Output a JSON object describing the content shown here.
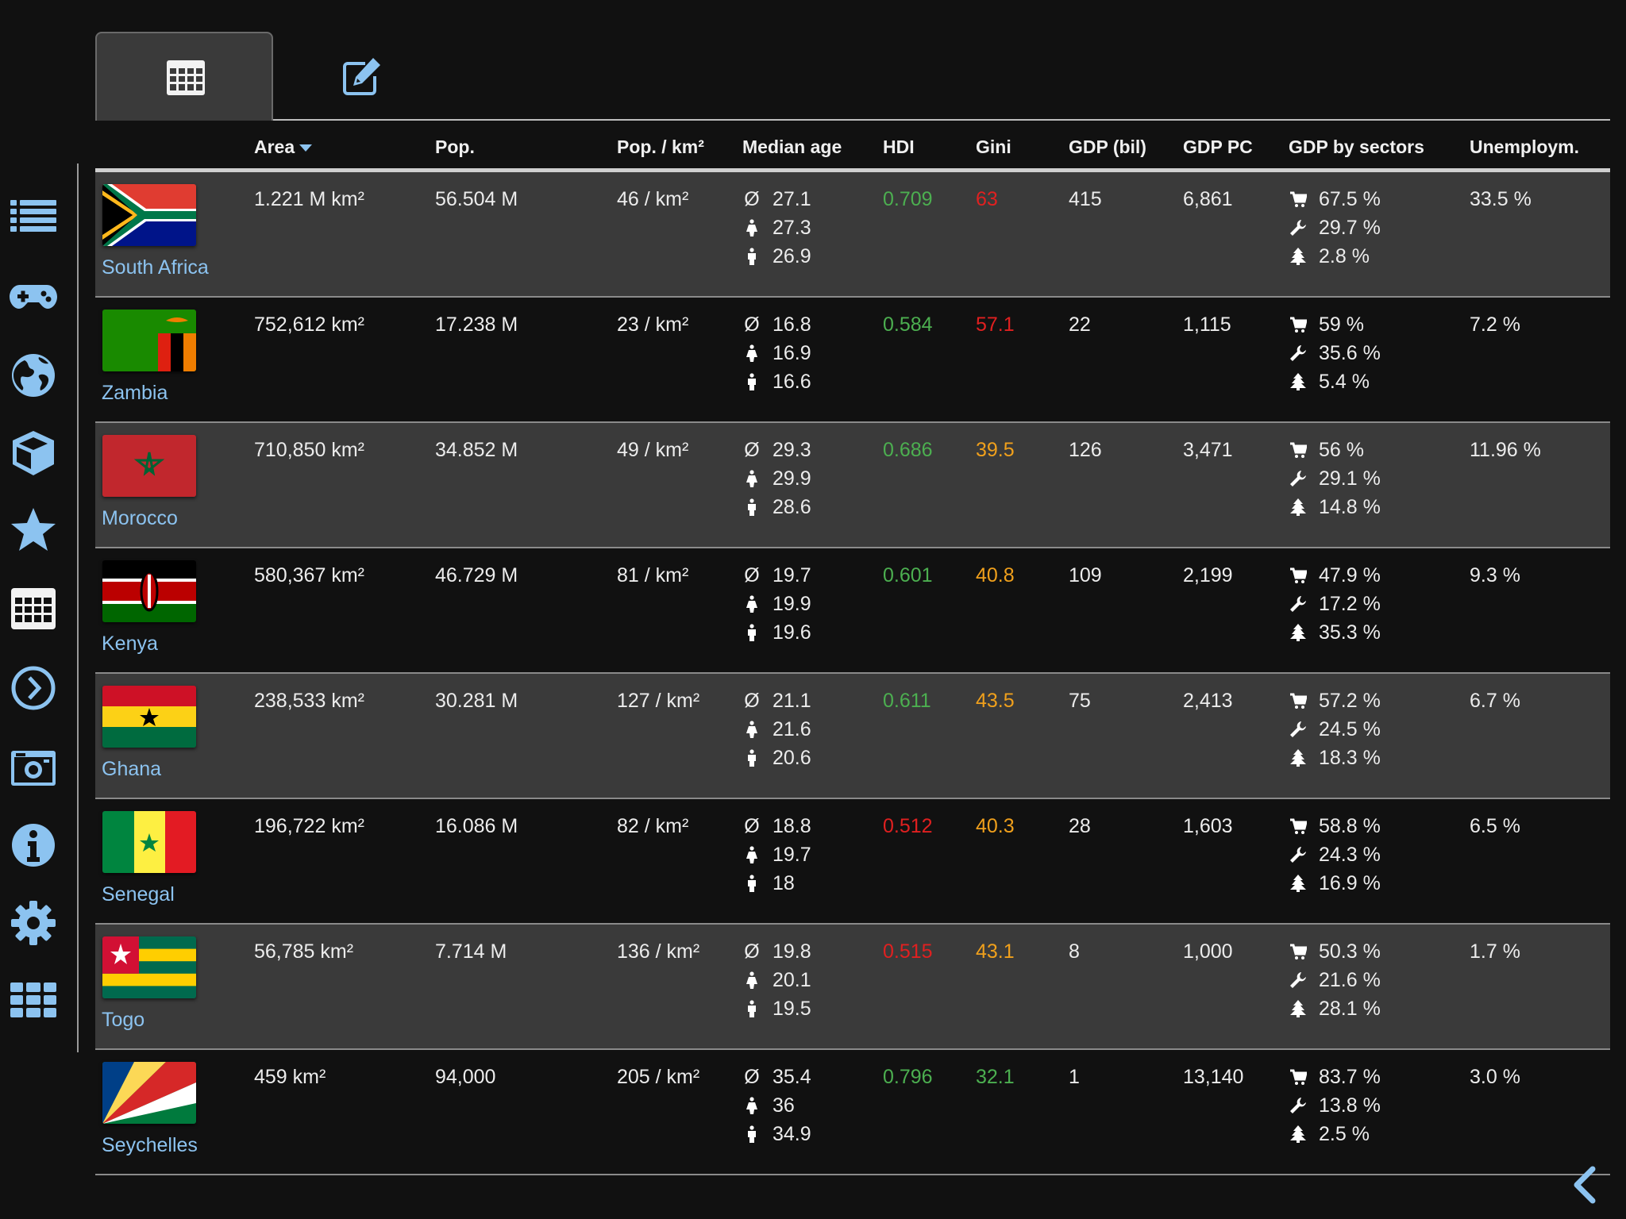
{
  "colors": {
    "accent": "#8cc3f0",
    "good": "#4caf50",
    "bad": "#e02020",
    "medium": "#f0a01c",
    "row_alt": "#3a3a3a"
  },
  "sidebar": {
    "icons": [
      "list-icon",
      "gamepad-icon",
      "globe-icon",
      "cube-icon",
      "star-icon",
      "calendar-grid-icon",
      "clock-arrow-icon",
      "camera-icon",
      "info-icon",
      "gear-icon",
      "apps-grid-icon"
    ]
  },
  "tabs": [
    {
      "icon": "table-icon",
      "active": true
    },
    {
      "icon": "edit-icon",
      "active": false
    }
  ],
  "table": {
    "columns": [
      "Area",
      "Pop.",
      "Pop. / km²",
      "Median age",
      "HDI",
      "Gini",
      "GDP (bil)",
      "GDP PC",
      "GDP by sectors",
      "Unemploym."
    ],
    "sorted_column": "Area",
    "age_symbol": "Ø",
    "rows": [
      {
        "country": "South Africa",
        "flag": "south-africa-flag",
        "area": "1.221 M km²",
        "pop": "56.504 M",
        "density": "46 / km²",
        "age_avg": "27.1",
        "age_f": "27.3",
        "age_m": "26.9",
        "hdi": "0.709",
        "hdi_level": "good",
        "gini": "63",
        "gini_level": "bad",
        "gdp": "415",
        "gdppc": "6,861",
        "services": "67.5 %",
        "industry": "29.7 %",
        "agriculture": "2.8 %",
        "unemp": "33.5 %"
      },
      {
        "country": "Zambia",
        "flag": "zambia-flag",
        "area": "752,612 km²",
        "pop": "17.238 M",
        "density": "23 / km²",
        "age_avg": "16.8",
        "age_f": "16.9",
        "age_m": "16.6",
        "hdi": "0.584",
        "hdi_level": "good",
        "gini": "57.1",
        "gini_level": "bad",
        "gdp": "22",
        "gdppc": "1,115",
        "services": "59 %",
        "industry": "35.6 %",
        "agriculture": "5.4 %",
        "unemp": "7.2 %"
      },
      {
        "country": "Morocco",
        "flag": "morocco-flag",
        "area": "710,850 km²",
        "pop": "34.852 M",
        "density": "49 / km²",
        "age_avg": "29.3",
        "age_f": "29.9",
        "age_m": "28.6",
        "hdi": "0.686",
        "hdi_level": "good",
        "gini": "39.5",
        "gini_level": "medium",
        "gdp": "126",
        "gdppc": "3,471",
        "services": "56 %",
        "industry": "29.1 %",
        "agriculture": "14.8 %",
        "unemp": "11.96 %"
      },
      {
        "country": "Kenya",
        "flag": "kenya-flag",
        "area": "580,367 km²",
        "pop": "46.729 M",
        "density": "81 / km²",
        "age_avg": "19.7",
        "age_f": "19.9",
        "age_m": "19.6",
        "hdi": "0.601",
        "hdi_level": "good",
        "gini": "40.8",
        "gini_level": "medium",
        "gdp": "109",
        "gdppc": "2,199",
        "services": "47.9 %",
        "industry": "17.2 %",
        "agriculture": "35.3 %",
        "unemp": "9.3 %"
      },
      {
        "country": "Ghana",
        "flag": "ghana-flag",
        "area": "238,533 km²",
        "pop": "30.281 M",
        "density": "127 / km²",
        "age_avg": "21.1",
        "age_f": "21.6",
        "age_m": "20.6",
        "hdi": "0.611",
        "hdi_level": "good",
        "gini": "43.5",
        "gini_level": "medium",
        "gdp": "75",
        "gdppc": "2,413",
        "services": "57.2 %",
        "industry": "24.5 %",
        "agriculture": "18.3 %",
        "unemp": "6.7 %"
      },
      {
        "country": "Senegal",
        "flag": "senegal-flag",
        "area": "196,722 km²",
        "pop": "16.086 M",
        "density": "82 / km²",
        "age_avg": "18.8",
        "age_f": "19.7",
        "age_m": "18",
        "hdi": "0.512",
        "hdi_level": "bad",
        "gini": "40.3",
        "gini_level": "medium",
        "gdp": "28",
        "gdppc": "1,603",
        "services": "58.8 %",
        "industry": "24.3 %",
        "agriculture": "16.9 %",
        "unemp": "6.5 %"
      },
      {
        "country": "Togo",
        "flag": "togo-flag",
        "area": "56,785 km²",
        "pop": "7.714 M",
        "density": "136 / km²",
        "age_avg": "19.8",
        "age_f": "20.1",
        "age_m": "19.5",
        "hdi": "0.515",
        "hdi_level": "bad",
        "gini": "43.1",
        "gini_level": "medium",
        "gdp": "8",
        "gdppc": "1,000",
        "services": "50.3 %",
        "industry": "21.6 %",
        "agriculture": "28.1 %",
        "unemp": "1.7 %"
      },
      {
        "country": "Seychelles",
        "flag": "seychelles-flag",
        "area": "459 km²",
        "pop": "94,000",
        "density": "205 / km²",
        "age_avg": "35.4",
        "age_f": "36",
        "age_m": "34.9",
        "hdi": "0.796",
        "hdi_level": "good",
        "gini": "32.1",
        "gini_level": "good",
        "gdp": "1",
        "gdppc": "13,140",
        "services": "83.7 %",
        "industry": "13.8 %",
        "agriculture": "2.5 %",
        "unemp": "3.0 %"
      }
    ]
  },
  "footer": {
    "icon": "chevron-left-icon"
  }
}
